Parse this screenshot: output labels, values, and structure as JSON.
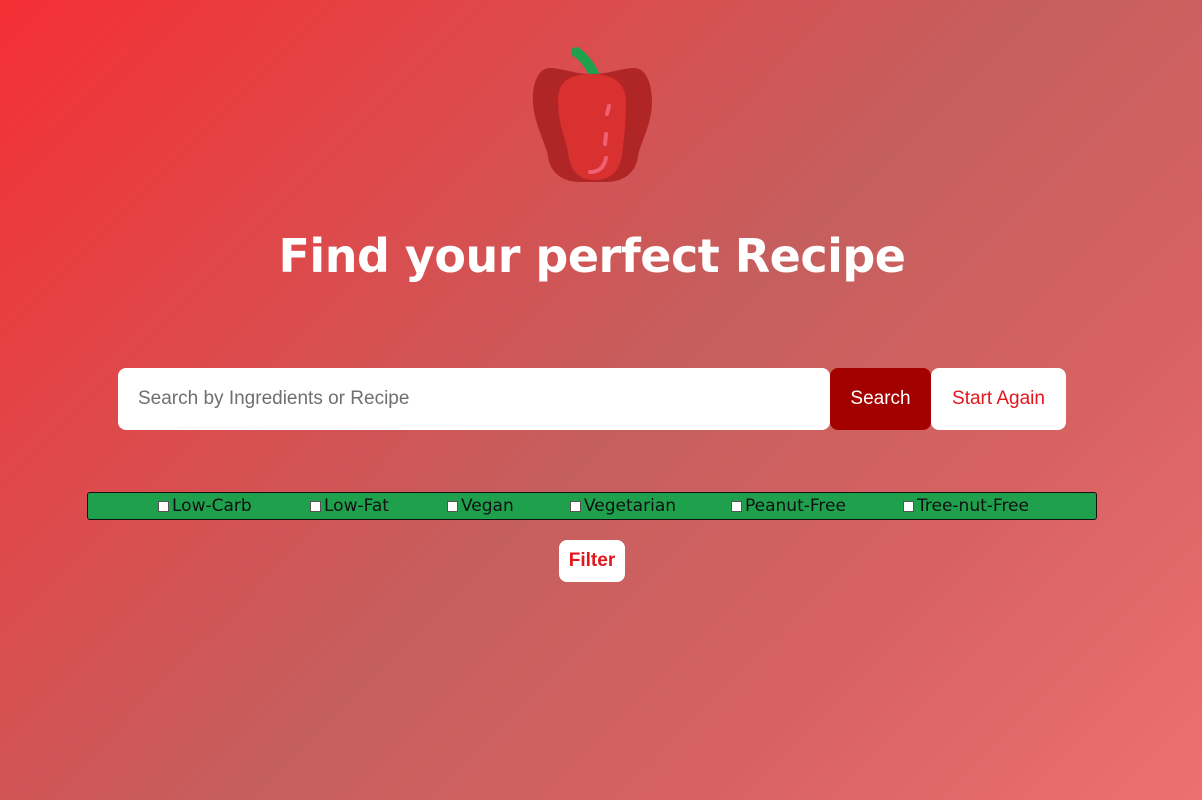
{
  "header": {
    "logo_icon": "bell-pepper-icon",
    "title": "Find your perfect Recipe"
  },
  "search": {
    "placeholder": "Search by Ingredients or Recipe",
    "value": "",
    "search_label": "Search",
    "start_again_label": "Start Again"
  },
  "filters": {
    "options": [
      {
        "label": "Low-Carb",
        "checked": false
      },
      {
        "label": "Low-Fat",
        "checked": false
      },
      {
        "label": "Vegan",
        "checked": false
      },
      {
        "label": "Vegetarian",
        "checked": false
      },
      {
        "label": "Peanut-Free",
        "checked": false
      },
      {
        "label": "Tree-nut-Free",
        "checked": false
      }
    ],
    "filter_label": "Filter"
  },
  "colors": {
    "gradient_start": "#f42f34",
    "gradient_end": "#ed7070",
    "search_button": "#a30000",
    "accent_text": "#e3161c",
    "filter_bar": "#1fa04d",
    "pepper_stem": "#1fa04d",
    "pepper_body": "#d93030"
  }
}
